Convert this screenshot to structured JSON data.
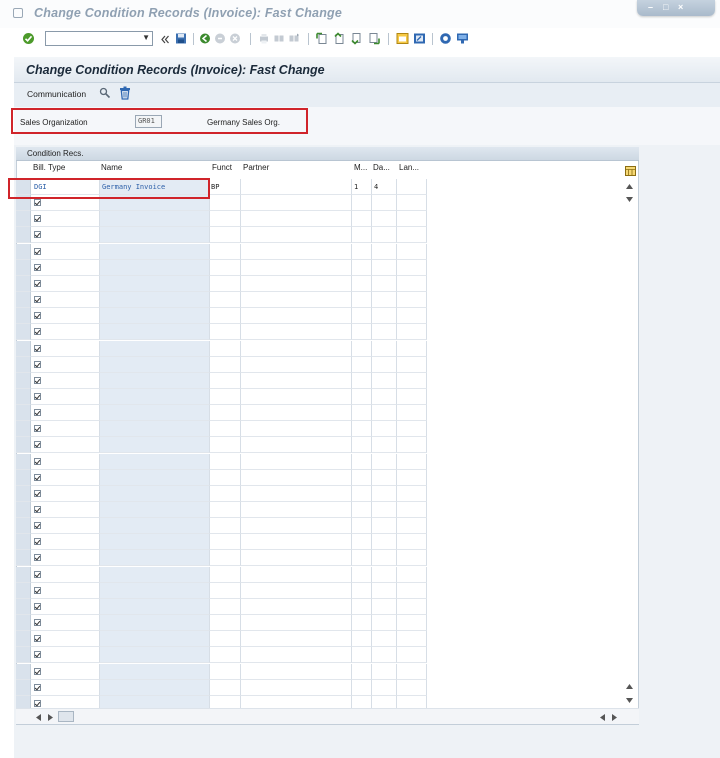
{
  "window": {
    "title": "Change Condition Records (Invoice): Fast Change",
    "controls": [
      "minimize-icon",
      "restore-icon",
      "close-icon"
    ]
  },
  "toolbar": {
    "command_field_value": "",
    "icons": [
      "enter-icon",
      "save-icon",
      "back-icon",
      "exit-icon",
      "cancel-icon",
      "print-icon",
      "find-icon",
      "find-next-icon",
      "first-page-icon",
      "previous-page-icon",
      "next-page-icon",
      "last-page-icon",
      "new-session-icon",
      "shortcut-icon",
      "help-icon",
      "customize-layout-icon"
    ]
  },
  "header": {
    "title": "Change Condition Records (Invoice): Fast Change"
  },
  "app_toolbar": {
    "communication_label": "Communication"
  },
  "form": {
    "sales_org_label": "Sales Organization",
    "sales_org_value": "GR01",
    "sales_org_desc": "Germany Sales Org."
  },
  "table": {
    "title": "Condition Recs.",
    "columns": [
      "Bill. Type",
      "Name",
      "Funct",
      "Partner",
      "M...",
      "Da...",
      "Lan..."
    ],
    "rows": [
      {
        "bill_type": "DGI",
        "name": "Germany Invoice",
        "funct": "BP",
        "partner": "",
        "m": "1",
        "da": "4",
        "lan": ""
      }
    ],
    "empty_rows": 32
  },
  "colors": {
    "highlight_red": "#d0242a",
    "header_bg": "#e2e9f0",
    "link_blue": "#2c5fa8"
  }
}
